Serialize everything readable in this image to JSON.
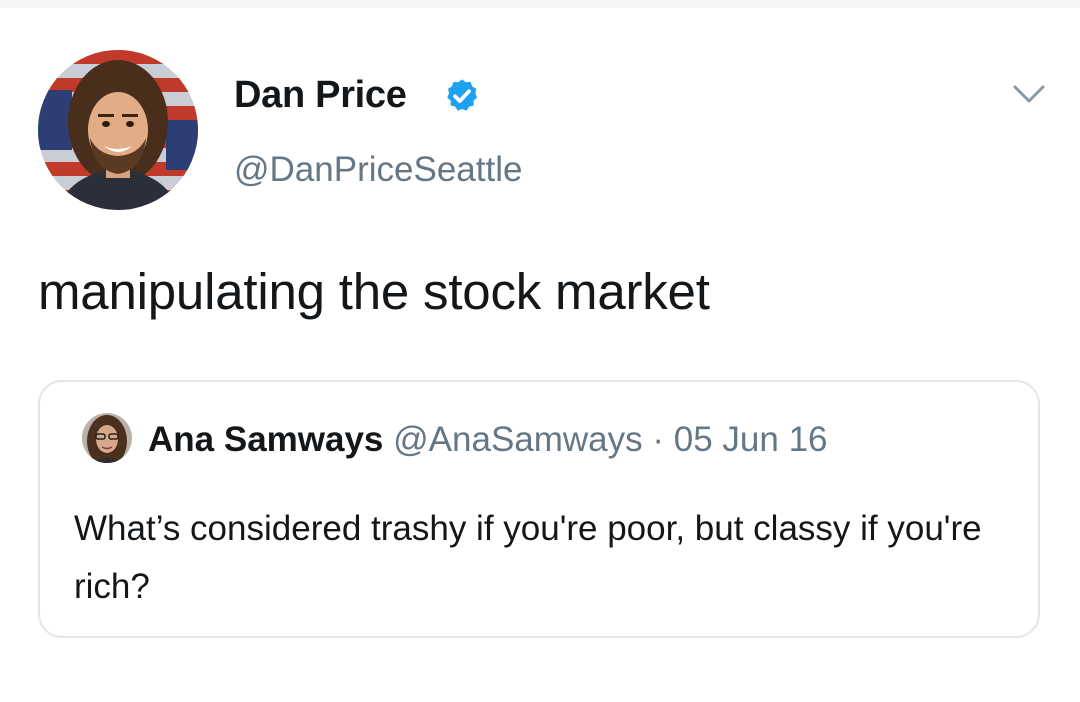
{
  "tweet": {
    "author_name": "Dan Price",
    "author_handle": "@DanPriceSeattle",
    "text": "manipulating the stock market",
    "verified": true
  },
  "quoted_tweet": {
    "author_name": "Ana Samways",
    "author_handle": "@AnaSamways",
    "separator": " · ",
    "date": "05 Jun 16",
    "text": "What’s considered trashy if you're poor, but classy if you're rich?"
  },
  "icons": {
    "verified": "verified-badge-icon",
    "menu": "chevron-down-icon"
  },
  "colors": {
    "verified_blue": "#1da1f2",
    "secondary_text": "#657786",
    "card_border": "#e1e8ed"
  }
}
